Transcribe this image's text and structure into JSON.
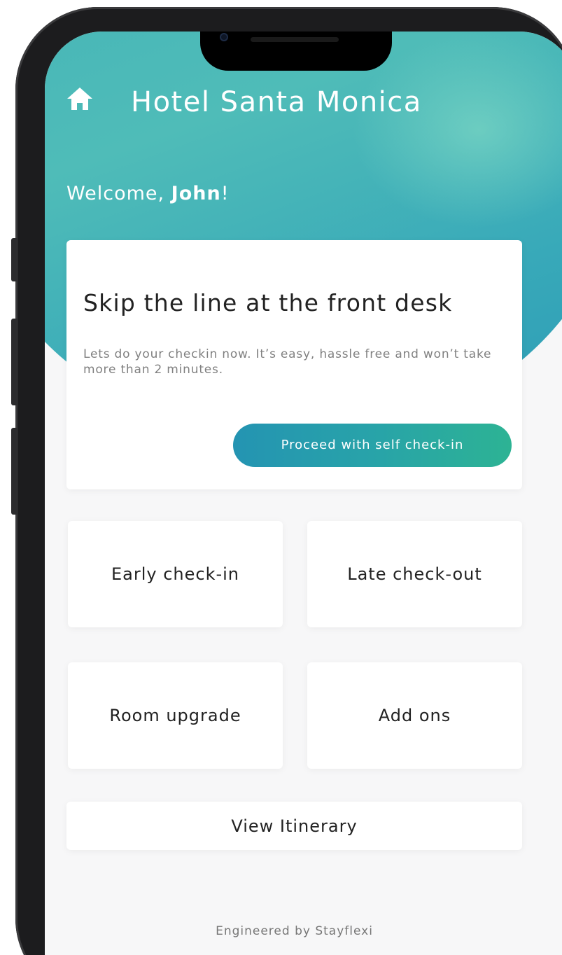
{
  "header": {
    "icon": "home-icon",
    "title": "Hotel Santa Monica",
    "welcome_prefix": "Welcome, ",
    "guest_name": "John",
    "welcome_suffix": "!"
  },
  "hero": {
    "title": "Skip the line at the front desk",
    "description": "Lets do your checkin now. It’s easy, hassle free and won’t take more than 2 minutes.",
    "cta_label": "Proceed with self check-in"
  },
  "tiles": [
    {
      "label": "Early check-in"
    },
    {
      "label": "Late check-out"
    },
    {
      "label": "Room upgrade"
    },
    {
      "label": "Add ons"
    }
  ],
  "itinerary_label": "View Itinerary",
  "footer_text": "Engineered by Stayflexi",
  "colors": {
    "header_gradient": [
      "#3fb0b6",
      "#2b9ab5"
    ],
    "cta_gradient": [
      "#2494b2",
      "#2db394"
    ],
    "text_dark": "#222222",
    "text_muted": "#808080"
  }
}
